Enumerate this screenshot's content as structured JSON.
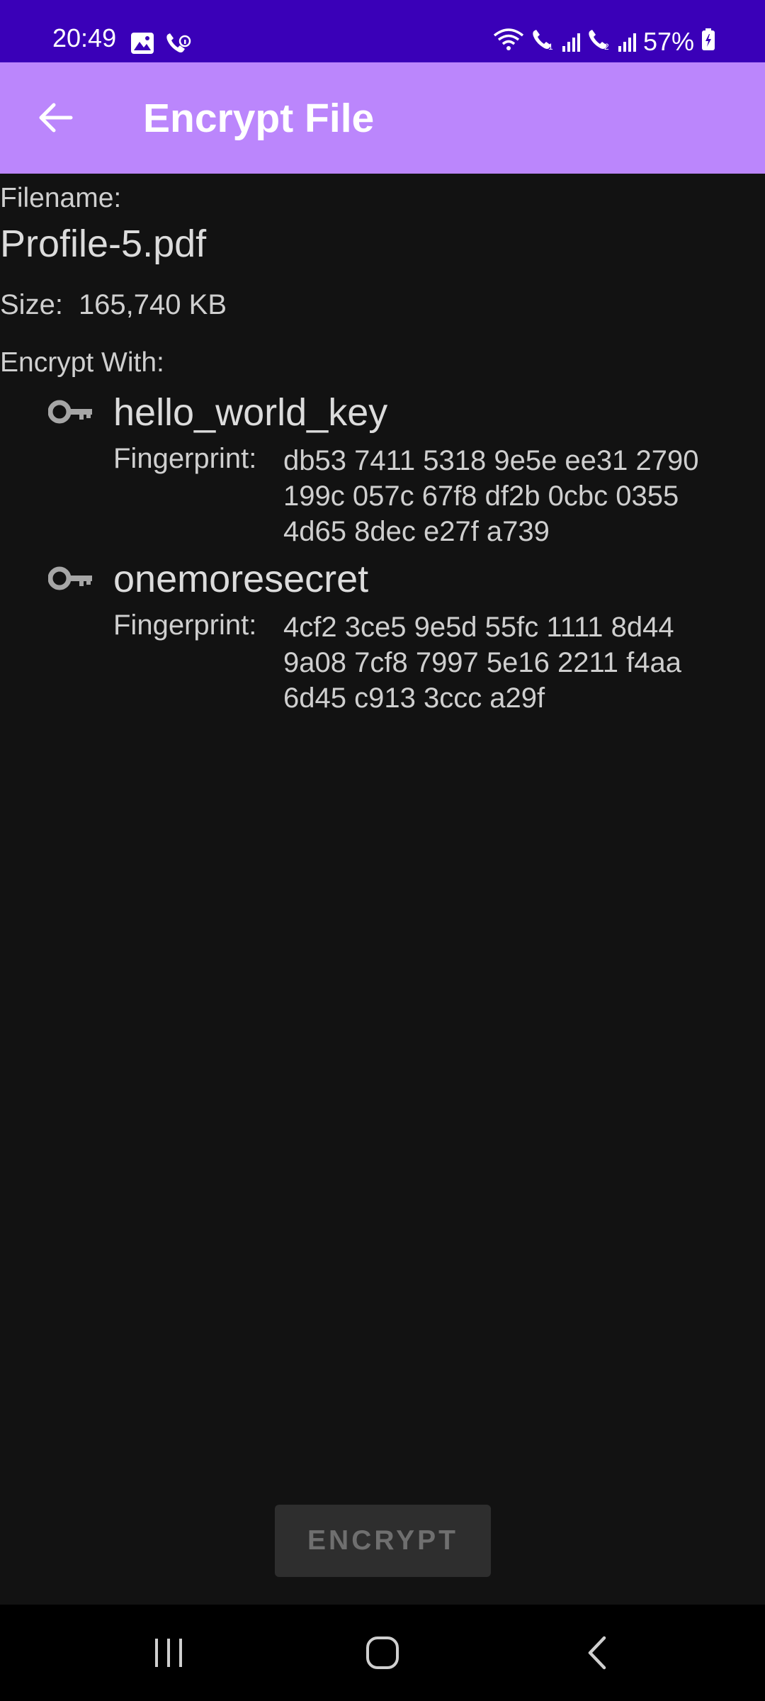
{
  "status_bar": {
    "time": "20:49",
    "battery": "57%",
    "left_icons": [
      "image-icon",
      "wifi-call-icon"
    ],
    "right_icons": [
      "wifi-icon",
      "call-1-icon",
      "signal-1-icon",
      "call-2-icon",
      "signal-2-icon",
      "battery-icon"
    ]
  },
  "app_bar": {
    "title": "Encrypt File",
    "back_icon": "arrow-back-icon"
  },
  "file": {
    "filename_label": "Filename:",
    "filename": "Profile-5.pdf",
    "size_label": "Size:",
    "size": "165,740 KB"
  },
  "encrypt_with": {
    "label": "Encrypt With:",
    "keys": [
      {
        "name": "hello_world_key",
        "fingerprint_label": "Fingerprint:",
        "fingerprint_lines": [
          "db53 7411 5318 9e5e ee31 2790",
          "199c 057c 67f8 df2b 0cbc 0355",
          "4d65 8dec e27f a739"
        ]
      },
      {
        "name": "onemoresecret",
        "fingerprint_label": "Fingerprint:",
        "fingerprint_lines": [
          "4cf2 3ce5 9e5d 55fc 1111 8d44",
          "9a08 7cf8 7997 5e16 2211 f4aa",
          "6d45 c913 3ccc a29f"
        ]
      }
    ]
  },
  "actions": {
    "encrypt_label": "ENCRYPT"
  },
  "colors": {
    "status_bar": "#3a00b8",
    "app_bar": "#bb86fc",
    "background": "#121212",
    "button_bg": "#2e2e2e"
  }
}
